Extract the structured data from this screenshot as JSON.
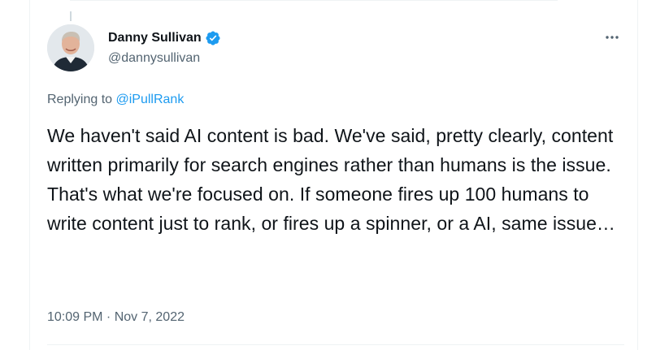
{
  "author": {
    "display_name": "Danny Sullivan",
    "handle": "@dannysullivan",
    "verified": true,
    "avatar_icon": "person-avatar"
  },
  "reply": {
    "prefix": "Replying to ",
    "mention": "@iPullRank"
  },
  "tweet": {
    "text": "We haven't said AI content is bad. We've said, pretty clearly, content written primarily for search engines rather than humans is the issue. That's what we're focused on. If someone fires up 100 humans to write content just to rank, or fires up a spinner, or a AI, same issue…"
  },
  "meta": {
    "timestamp": "10:09 PM · Nov 7, 2022"
  },
  "colors": {
    "accent": "#1d9bf0",
    "muted": "#536471",
    "text": "#0f1419"
  }
}
